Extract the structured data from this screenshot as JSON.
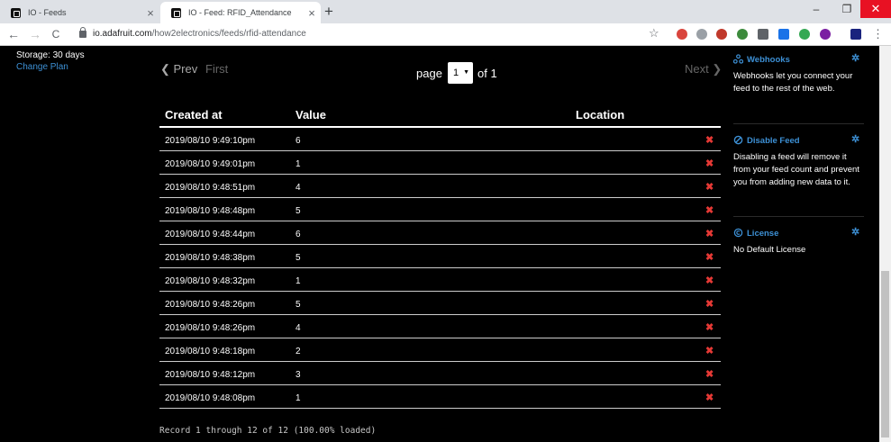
{
  "browser": {
    "tabs": [
      {
        "title": "IO - Feeds",
        "close": "×"
      },
      {
        "title": "IO - Feed: RFID_Attendance",
        "close": "×"
      }
    ],
    "new_tab": "+",
    "window": {
      "minimize": "–",
      "restore": "❐",
      "close": "✕"
    },
    "nav": {
      "back": "←",
      "forward": "→",
      "reload": "C"
    },
    "url_domain": "io.adafruit.com",
    "url_path": "/how2electronics/feeds/rfid-attendance",
    "star": "☆",
    "menu": "⋮",
    "extension_colors": [
      "#d9453d",
      "#9aa0a6",
      "#c0392b",
      "#3d8b3d",
      "#5f6368",
      "#1a73e8",
      "#34a853",
      "#7b1fa2",
      "#1a237e"
    ]
  },
  "account": {
    "storage": "Storage: 30 days",
    "change_plan": "Change Plan"
  },
  "pager": {
    "prev": "❮ Prev",
    "first": "First",
    "next": "Next ❯",
    "page_label": "page",
    "page_value": "1",
    "caret": "▼",
    "of": "of 1"
  },
  "table": {
    "headers": {
      "created": "Created at",
      "value": "Value",
      "location": "Location"
    },
    "rows": [
      {
        "created": "2019/08/10 9:49:10pm",
        "value": "6"
      },
      {
        "created": "2019/08/10 9:49:01pm",
        "value": "1"
      },
      {
        "created": "2019/08/10 9:48:51pm",
        "value": "4"
      },
      {
        "created": "2019/08/10 9:48:48pm",
        "value": "5"
      },
      {
        "created": "2019/08/10 9:48:44pm",
        "value": "6"
      },
      {
        "created": "2019/08/10 9:48:38pm",
        "value": "5"
      },
      {
        "created": "2019/08/10 9:48:32pm",
        "value": "1"
      },
      {
        "created": "2019/08/10 9:48:26pm",
        "value": "5"
      },
      {
        "created": "2019/08/10 9:48:26pm",
        "value": "4"
      },
      {
        "created": "2019/08/10 9:48:18pm",
        "value": "2"
      },
      {
        "created": "2019/08/10 9:48:12pm",
        "value": "3"
      },
      {
        "created": "2019/08/10 9:48:08pm",
        "value": "1"
      }
    ],
    "delete_glyph": "✖"
  },
  "record_info": "Record 1 through 12 of 12 (100.00% loaded)",
  "sidebar": {
    "webhooks": {
      "title": "Webhooks",
      "text": "Webhooks let you connect your feed to the rest of the web."
    },
    "disable": {
      "title": "Disable Feed",
      "text": "Disabling a feed will remove it from your feed count and prevent you from adding new data to it."
    },
    "license": {
      "title": "License",
      "text": "No Default License"
    },
    "gear": "✲"
  },
  "colors": {
    "accent": "#3d90d5",
    "delete": "#e53935",
    "background": "#000000"
  }
}
